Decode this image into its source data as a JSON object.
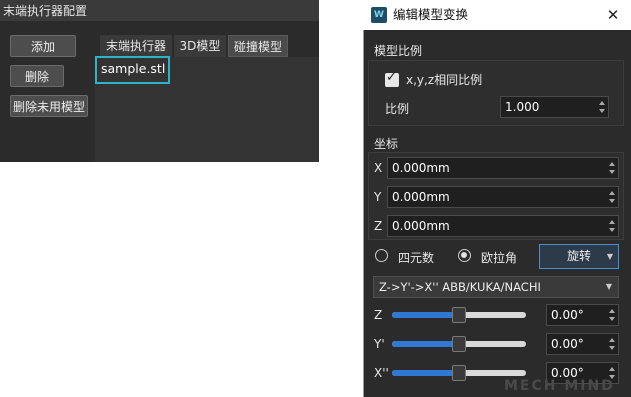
{
  "left_panel": {
    "title": "末端执行器配置",
    "buttons": {
      "add": "添加",
      "delete": "删除",
      "delete_unused": "删除未用模型"
    },
    "tabs": [
      "末端执行器",
      "3D模型",
      "碰撞模型"
    ],
    "active_tab": "碰撞模型",
    "files": [
      "sample.stl"
    ]
  },
  "dialog": {
    "title": "编辑模型变换",
    "close_icon": "close-icon",
    "app_icon_text": "W",
    "scale": {
      "section_title": "模型比例",
      "uniform_checkbox_label": "x,y,z相同比例",
      "uniform_checked": true,
      "ratio_label": "比例",
      "ratio_value": "1.000"
    },
    "coords": {
      "section_title": "坐标",
      "x_label": "X",
      "x_value": "0.000mm",
      "y_label": "Y",
      "y_value": "0.000mm",
      "z_label": "Z",
      "z_value": "0.000mm"
    },
    "rotation": {
      "quaternion_label": "四元数",
      "euler_label": "欧拉角",
      "selected_mode": "欧拉角",
      "rotate_button": "旋转",
      "order_value": "Z->Y'->X'' ABB/KUKA/NACHI",
      "sliders": [
        {
          "label": "Z",
          "value": "0.00°",
          "level": 0.5
        },
        {
          "label": "Y'",
          "value": "0.00°",
          "level": 0.5
        },
        {
          "label": "X''",
          "value": "0.00°",
          "level": 0.5
        }
      ]
    },
    "watermark": "MECH MIND"
  },
  "colors": {
    "accent_blue": "#2f78d4",
    "highlight_cyan": "#2fb3c6",
    "panel_bg": "#2b2b2b"
  }
}
